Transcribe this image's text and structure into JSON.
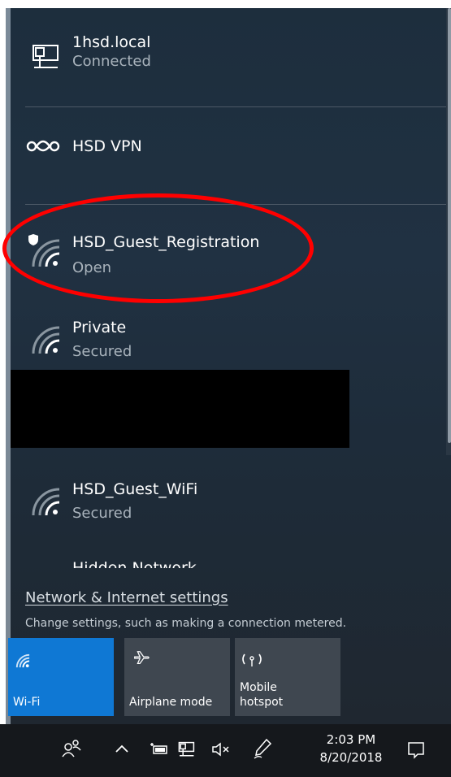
{
  "networks": [
    {
      "name": "1hsd.local",
      "status": "Connected",
      "icon": "ethernet-icon"
    },
    {
      "name": "HSD VPN",
      "status": "",
      "icon": "vpn-icon"
    },
    {
      "name": "HSD_Guest_Registration",
      "status": "Open",
      "icon": "wifi-open-icon"
    },
    {
      "name": "Private",
      "status": "Secured",
      "icon": "wifi-icon"
    },
    {
      "name": "HSD_Guest_WiFi",
      "status": "Secured",
      "icon": "wifi-icon"
    },
    {
      "name": "Hidden Network",
      "status": "",
      "icon": "wifi-icon"
    }
  ],
  "settings": {
    "link": "Network & Internet settings",
    "description": "Change settings, such as making a connection metered."
  },
  "quick_actions": [
    {
      "label": "Wi-Fi",
      "icon": "wifi-icon",
      "active": true
    },
    {
      "label": "Airplane mode",
      "icon": "airplane-icon",
      "active": false
    },
    {
      "label": "Mobile\nhotspot",
      "icon": "hotspot-icon",
      "active": false
    }
  ],
  "taskbar": {
    "time": "2:03 PM",
    "date": "8/20/2018",
    "icons": [
      "people-icon",
      "chevron-up-icon",
      "battery-icon",
      "network-icon",
      "volume-muted-icon",
      "pen-icon",
      "action-center-icon"
    ]
  },
  "colors": {
    "flyout_bg": "#1f2f3f",
    "accent": "#0f78d4",
    "annotation": "#ff0000"
  }
}
